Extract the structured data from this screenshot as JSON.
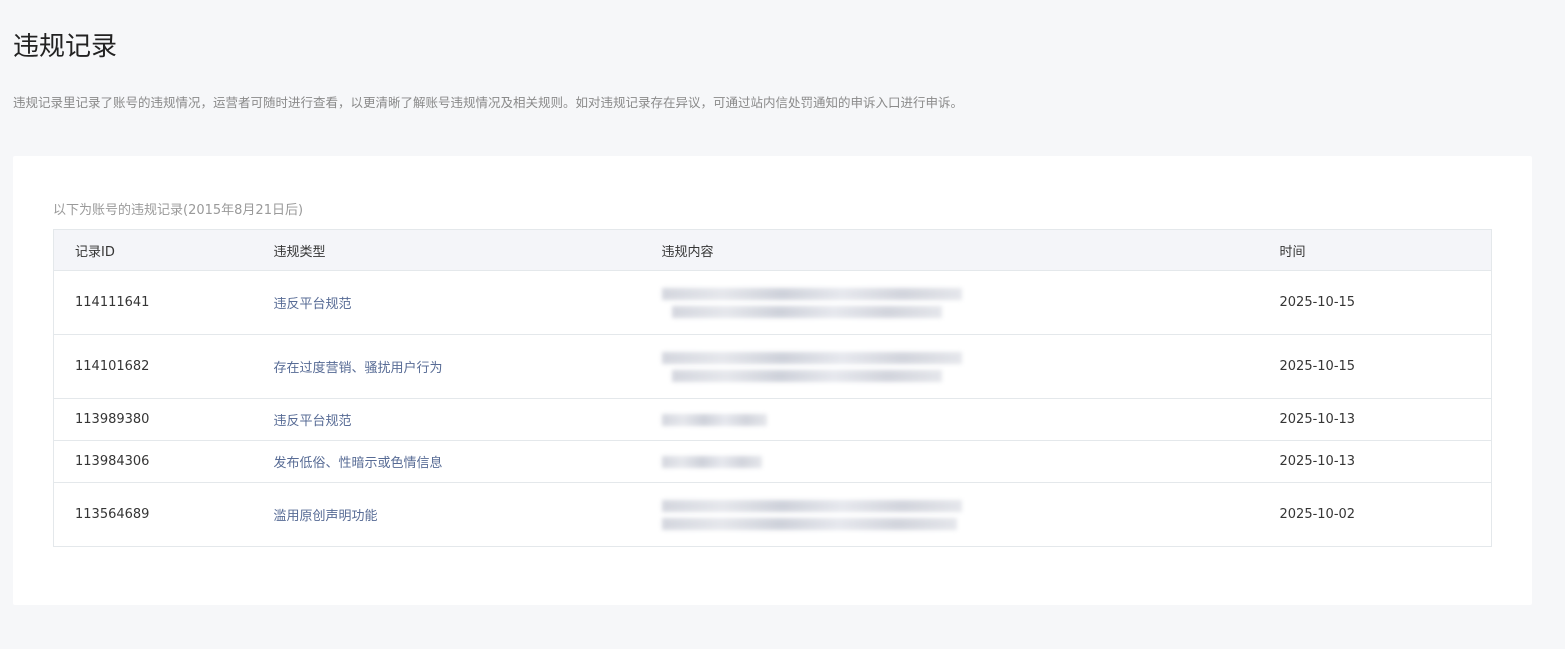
{
  "page": {
    "title": "违规记录",
    "description": "违规记录里记录了账号的违规情况，运营者可随时进行查看，以更清晰了解账号违规情况及相关规则。如对违规记录存在异议，可通过站内信处罚通知的申诉入口进行申诉。"
  },
  "records": {
    "subtitle": "以下为账号的违规记录(2015年8月21日后)",
    "headers": {
      "id": "记录ID",
      "type": "违规类型",
      "content": "违规内容",
      "time": "时间"
    },
    "rows": [
      {
        "id": "114111641",
        "type": "违反平台规范",
        "time": "2025-10-15"
      },
      {
        "id": "114101682",
        "type": "存在过度营销、骚扰用户行为",
        "time": "2025-10-15"
      },
      {
        "id": "113989380",
        "type": "违反平台规范",
        "time": "2025-10-13"
      },
      {
        "id": "113984306",
        "type": "发布低俗、性暗示或色情信息",
        "time": "2025-10-13"
      },
      {
        "id": "113564689",
        "type": "滥用原创声明功能",
        "time": "2025-10-02"
      }
    ]
  }
}
